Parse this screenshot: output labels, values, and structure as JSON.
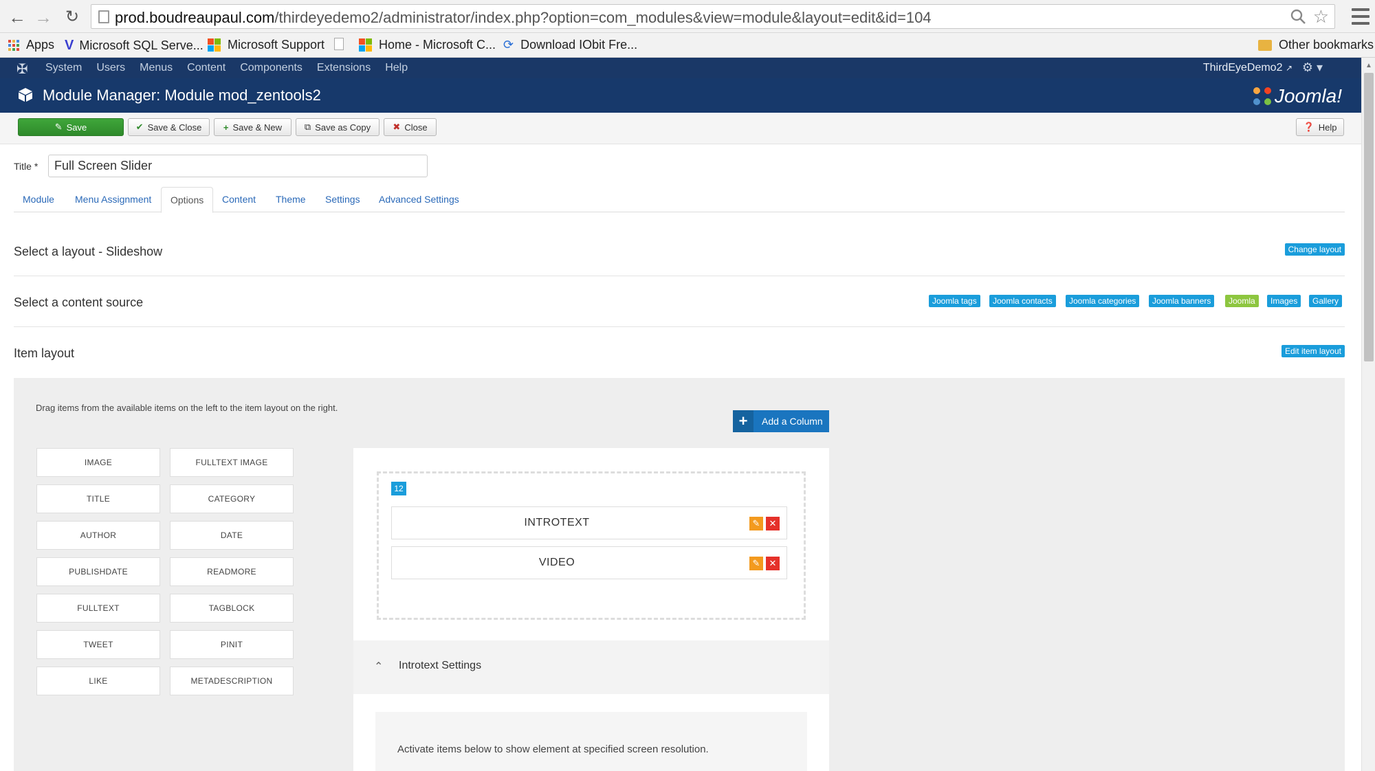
{
  "browser": {
    "url_host": "prod.boudreaupaul.com",
    "url_path": "/thirdeyedemo2/administrator/index.php?option=com_modules&view=module&layout=edit&id=104",
    "bookmarks": [
      {
        "label": "Apps"
      },
      {
        "label": "Microsoft SQL Serve..."
      },
      {
        "label": "Microsoft Support"
      },
      {
        "label": ""
      },
      {
        "label": "Home - Microsoft C..."
      },
      {
        "label": "Download IObit Fre..."
      }
    ],
    "other_bookmarks": "Other bookmarks"
  },
  "admin": {
    "menu": [
      "System",
      "Users",
      "Menus",
      "Content",
      "Components",
      "Extensions",
      "Help"
    ],
    "user": "ThirdEyeDemo2",
    "page_title": "Module Manager: Module mod_zentools2",
    "brand": "Joomla!"
  },
  "toolbar": {
    "save": "Save",
    "save_close": "Save & Close",
    "save_new": "Save & New",
    "save_copy": "Save as Copy",
    "close": "Close",
    "help": "Help"
  },
  "form": {
    "title_label": "Title *",
    "title_value": "Full Screen Slider"
  },
  "tabs": [
    {
      "label": "Module"
    },
    {
      "label": "Menu Assignment"
    },
    {
      "label": "Options"
    },
    {
      "label": "Content"
    },
    {
      "label": "Theme"
    },
    {
      "label": "Settings"
    },
    {
      "label": "Advanced Settings"
    }
  ],
  "sections": {
    "layout_title": "Select a layout - Slideshow",
    "change_layout": "Change layout",
    "source_title": "Select a content source",
    "sources": [
      "Joomla tags",
      "Joomla contacts",
      "Joomla categories",
      "Joomla banners",
      "Joomla",
      "Images",
      "Gallery"
    ],
    "item_layout_title": "Item layout",
    "edit_item_layout": "Edit item layout"
  },
  "item_layout": {
    "hint": "Drag items from the available items on the left to the item layout on the right.",
    "add_column": "Add a Column",
    "available_items": [
      "IMAGE",
      "FULLTEXT IMAGE",
      "TITLE",
      "CATEGORY",
      "AUTHOR",
      "DATE",
      "PUBLISHDATE",
      "READMORE",
      "FULLTEXT",
      "TAGBLOCK",
      "TWEET",
      "PINIT",
      "LIKE",
      "METADESCRIPTION"
    ],
    "column_width": "12",
    "column_items": [
      "INTROTEXT",
      "VIDEO"
    ],
    "settings_title": "Introtext Settings",
    "activate_text": "Activate items below to show element at specified screen resolution."
  },
  "colors": {
    "admin_bar": "#1a3867",
    "title_bar": "#17396b",
    "save_green": "#3fa63a",
    "tag_blue": "#1a9ddb",
    "tag_green": "#8dc63f",
    "edit_orange": "#f39a1e",
    "delete_red": "#e5312a"
  }
}
